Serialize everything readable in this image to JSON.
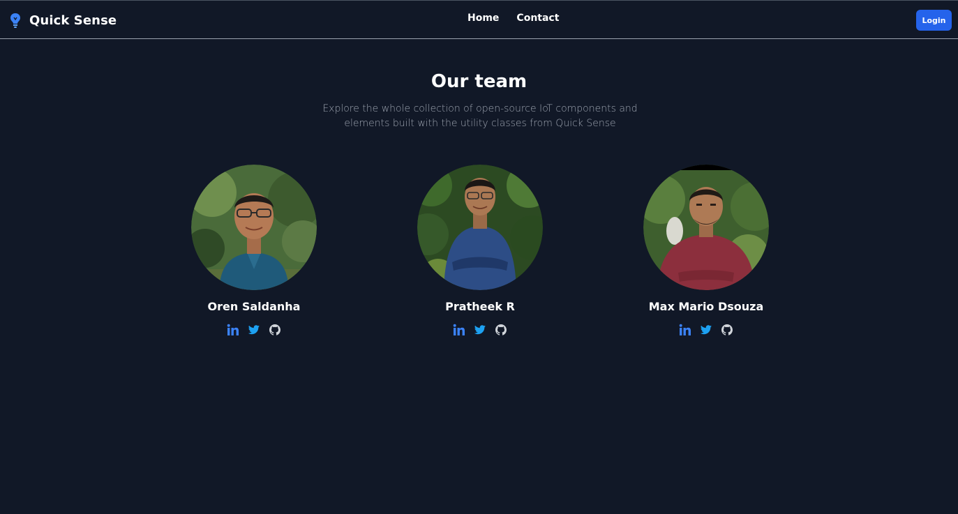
{
  "navbar": {
    "brand_name": "Quick Sense",
    "brand_icon": "lightbulb-icon",
    "links": [
      {
        "label": "Home"
      },
      {
        "label": "Contact"
      }
    ],
    "login_label": "Login"
  },
  "main": {
    "heading": "Our team",
    "subtitle": "Explore the whole collection of open-source IoT components and elements built with the utility classes from Quick Sense"
  },
  "team": [
    {
      "name": "Oren Saldanha",
      "socials": [
        "linkedin-icon",
        "twitter-icon",
        "github-icon"
      ]
    },
    {
      "name": "Pratheek R",
      "socials": [
        "linkedin-icon",
        "twitter-icon",
        "github-icon"
      ]
    },
    {
      "name": "Max Mario Dsouza",
      "socials": [
        "linkedin-icon",
        "twitter-icon",
        "github-icon"
      ]
    }
  ],
  "colors": {
    "background": "#111827",
    "accent": "#2563eb",
    "linkedin": "#3b82f6",
    "twitter": "#1da1f2",
    "github": "#d1d5db",
    "subtitle": "#9ca3af"
  }
}
